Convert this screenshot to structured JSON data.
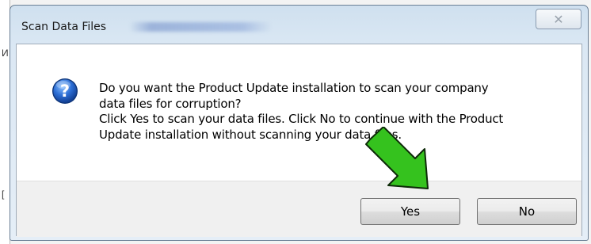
{
  "dialog": {
    "title": "Scan Data Files",
    "close_glyph": "✕",
    "message_lines": [
      "Do you want the Product Update installation to scan your company",
      "data files for corruption?",
      "Click Yes to scan your data files. Click No to continue with the Product",
      "Update installation without scanning your data files."
    ],
    "buttons": {
      "yes": "Yes",
      "no": "No"
    },
    "icon": "question-icon"
  },
  "annotation": {
    "icon": "arrow-pointer-icon",
    "color": "#35c21e"
  },
  "background": {
    "marks": [
      "И",
      "["
    ]
  }
}
